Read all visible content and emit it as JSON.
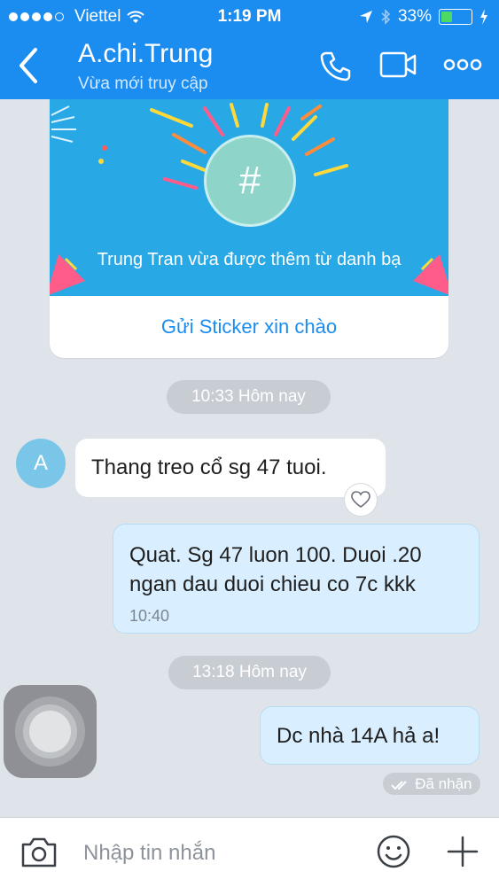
{
  "status_bar": {
    "carrier": "Viettel",
    "time": "1:19 PM",
    "battery": "33%",
    "battery_level": 0.33,
    "signal_bars": 4
  },
  "header": {
    "title": "A.chi.Trung",
    "subtitle": "Vừa mới truy cập",
    "icons": [
      "back-icon",
      "phone-icon",
      "video-call-icon",
      "more-icon"
    ]
  },
  "contact_card": {
    "symbol": "#",
    "banner_text": "Trung Tran vừa được thêm từ danh bạ",
    "action_label": "Gửi Sticker xin chào"
  },
  "messages": {
    "pill_1": "10:33 Hôm nay",
    "avatar_initial": "A",
    "incoming_1": "Thang treo cổ sg 47 tuoi.",
    "outgoing_1": "Quat. Sg 47 luon 100. Duoi .20 ngan dau duoi chieu co 7c kkk",
    "outgoing_1_time": "10:40",
    "pill_2": "13:18 Hôm nay",
    "outgoing_2": "Dc nhà 14A hả a!",
    "seen_status": "Đã nhận"
  },
  "input_bar": {
    "placeholder": "Nhập tin nhắn",
    "icons": [
      "camera-icon",
      "emoji-icon",
      "plus-icon"
    ]
  },
  "colors": {
    "header_bg": "#1b8cf0",
    "chat_bg": "#dfe3ea",
    "outgoing_bubble": "#d9efff",
    "link": "#1b8cf0"
  }
}
